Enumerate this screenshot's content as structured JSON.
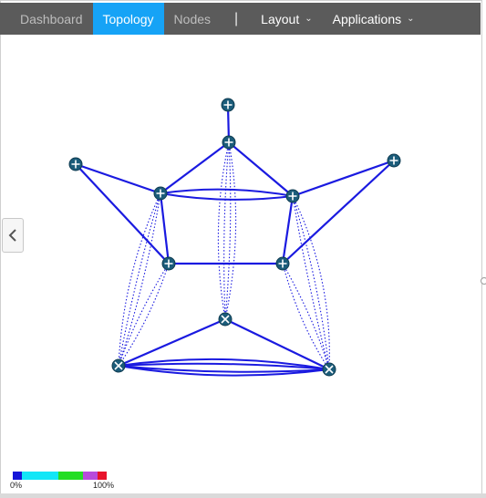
{
  "nav": {
    "items": [
      {
        "label": "Dashboard",
        "active": false
      },
      {
        "label": "Topology",
        "active": true
      },
      {
        "label": "Nodes",
        "active": false
      }
    ],
    "separator": "|",
    "menus": [
      {
        "label": "Layout",
        "icon": "chevron-down-icon"
      },
      {
        "label": "Applications",
        "icon": "chevron-down-icon"
      }
    ]
  },
  "side_toggle": {
    "icon": "chevron-left-icon"
  },
  "topology": {
    "link_color": "#1a1ae0",
    "node_color": "#1b5c7a",
    "nodes": [
      {
        "id": "top-end",
        "type": "host"
      },
      {
        "id": "top-hub",
        "type": "router"
      },
      {
        "id": "left-end",
        "type": "host"
      },
      {
        "id": "right-end",
        "type": "host"
      },
      {
        "id": "upper-left",
        "type": "router"
      },
      {
        "id": "upper-right",
        "type": "router"
      },
      {
        "id": "mid-left",
        "type": "router"
      },
      {
        "id": "mid-right",
        "type": "router"
      },
      {
        "id": "lower-center",
        "type": "switch"
      },
      {
        "id": "bottom-left",
        "type": "switch"
      },
      {
        "id": "bottom-right",
        "type": "switch"
      }
    ]
  },
  "legend": {
    "min_label": "0%",
    "max_label": "100%",
    "colors": [
      "#1515d8",
      "#12e6f7",
      "#12e6f7",
      "#24dd24",
      "#b84bdb",
      "#e8132b"
    ]
  }
}
